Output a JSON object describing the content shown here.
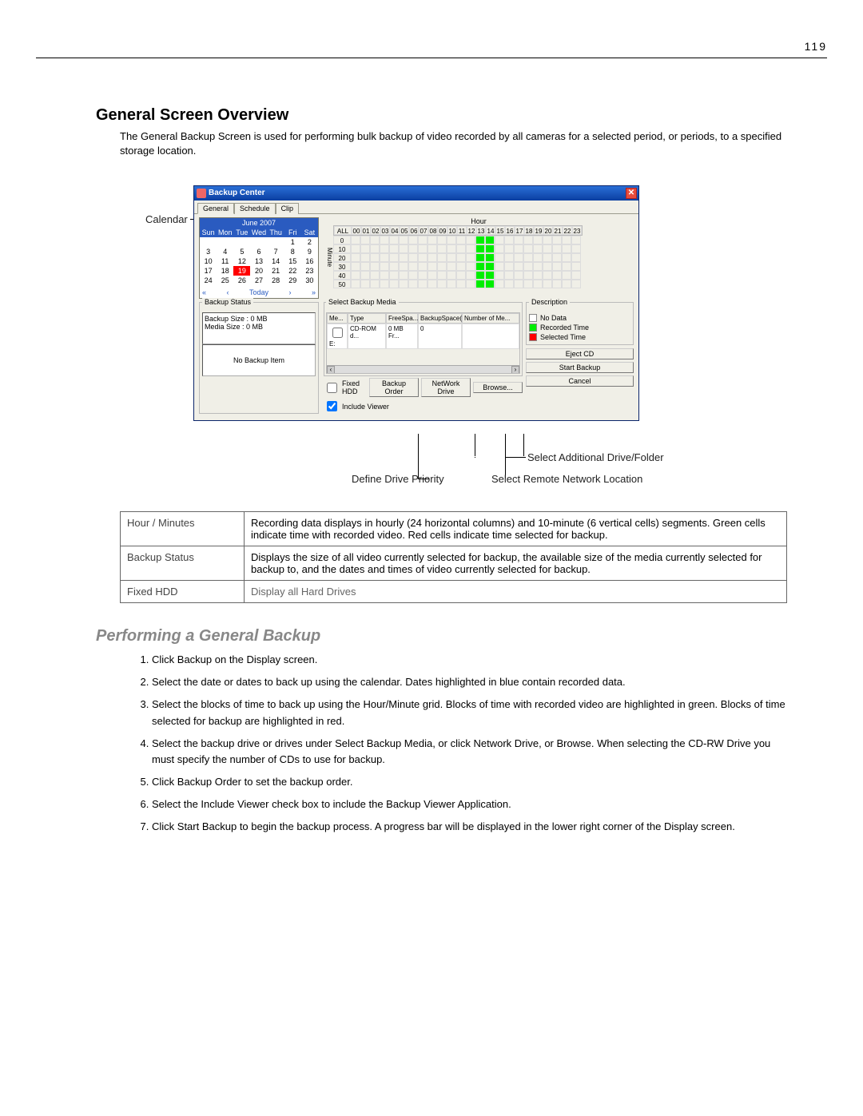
{
  "page_number": "119",
  "section_title": "General Screen Overview",
  "intro_text": "The General Backup Screen is used for performing bulk backup of video recorded by all cameras for a selected period, or periods, to a specified storage location.",
  "callouts": {
    "calendar": "Calendar",
    "select_additional": "Select Additional Drive/Folder",
    "define_priority": "Define Drive Priority",
    "select_remote": "Select Remote Network Location"
  },
  "window": {
    "title": "Backup Center",
    "tabs": [
      "General",
      "Schedule",
      "Clip"
    ],
    "calendar": {
      "month": "June 2007",
      "weekdays": [
        "Sun",
        "Mon",
        "Tue",
        "Wed",
        "Thu",
        "Fri",
        "Sat"
      ],
      "days": [
        "",
        "",
        "",
        "",
        "",
        "1",
        "2",
        "3",
        "4",
        "5",
        "6",
        "7",
        "8",
        "9",
        "10",
        "11",
        "12",
        "13",
        "14",
        "15",
        "16",
        "17",
        "18",
        "19",
        "20",
        "21",
        "22",
        "23",
        "24",
        "25",
        "26",
        "27",
        "28",
        "29",
        "30",
        "",
        ""
      ],
      "selected": "19",
      "nav_first": "«",
      "nav_prev": "‹",
      "today": "Today",
      "nav_next": "›",
      "nav_last": "»"
    },
    "hour_label": "Hour",
    "minute_label": "Minute",
    "hour_cols": [
      "ALL",
      "00",
      "01",
      "02",
      "03",
      "04",
      "05",
      "06",
      "07",
      "08",
      "09",
      "10",
      "11",
      "12",
      "13",
      "14",
      "15",
      "16",
      "17",
      "18",
      "19",
      "20",
      "21",
      "22",
      "23"
    ],
    "minute_rows": [
      "0",
      "10",
      "20",
      "30",
      "40",
      "50"
    ],
    "backup_status": {
      "title": "Backup Status",
      "line1": "Backup Size : 0 MB",
      "line2": "Media Size : 0 MB",
      "empty": "No Backup Item"
    },
    "media": {
      "title": "Select Backup Media",
      "cols": [
        "Me...",
        "Type",
        "FreeSpa...",
        "BackupSpace(...",
        "Number of Me..."
      ],
      "row": [
        "E:",
        "CD-ROM d...",
        "0 MB Fr...",
        "0",
        ""
      ]
    },
    "description": {
      "title": "Description",
      "no_data": "No Data",
      "recorded": "Recorded Time",
      "selected": "Selected Time"
    },
    "fixed_hdd": "Fixed HDD",
    "include_viewer": "Include Viewer",
    "buttons": {
      "backup_order": "Backup Order",
      "network_drive": "NetWork Drive",
      "browse": "Browse...",
      "eject": "Eject CD",
      "start": "Start Backup",
      "cancel": "Cancel"
    }
  },
  "desc_table": [
    {
      "label": "Hour / Minutes",
      "text": "Recording data displays in hourly (24 horizontal columns) and 10-minute (6 vertical cells) segments. Green cells indicate time with recorded video. Red cells indicate time selected for backup."
    },
    {
      "label": "Backup Status",
      "text": "Displays the size of all video currently selected for backup, the available size of the media currently selected for backup to, and the dates and times of video currently selected for backup."
    },
    {
      "label": "Fixed HDD",
      "text": "Display all Hard Drives"
    }
  ],
  "subsection_title": "Performing a General Backup",
  "steps": [
    "Click Backup on the Display screen.",
    "Select the date or dates to back up using the calendar. Dates highlighted in blue contain recorded data.",
    "Select the blocks of time to back up using the Hour/Minute grid. Blocks of time with recorded video are highlighted in green. Blocks of time selected for backup are highlighted in red.",
    "Select the backup drive or drives under Select Backup Media, or click Network Drive, or Browse. When selecting the CD-RW Drive you must specify the number of CDs to use for backup.",
    "Click Backup Order to set the backup order.",
    "Select the Include Viewer check box to include the Backup Viewer Application.",
    "Click Start Backup to begin the backup process. A progress bar will be displayed in the lower right corner of the Display screen."
  ]
}
